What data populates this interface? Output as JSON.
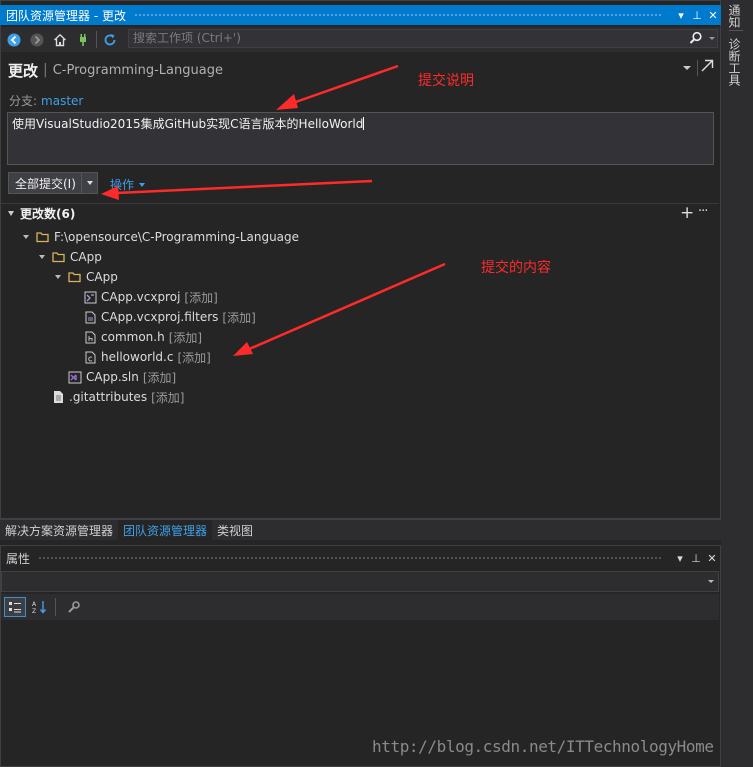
{
  "window": {
    "title": "团队资源管理器 - 更改",
    "controls": {
      "dropdown": "▾",
      "pin": "⊥",
      "close": "✕"
    }
  },
  "toolbar": {
    "buttons": [
      "back-icon",
      "forward-icon",
      "home-icon",
      "connect-icon",
      "refresh-icon"
    ],
    "search_placeholder": "搜索工作项 (Ctrl+')"
  },
  "page": {
    "title": "更改",
    "separator": "|",
    "repo": "C-Programming-Language"
  },
  "branch": {
    "label": "分支:",
    "value": "master"
  },
  "commit": {
    "message": "使用VisualStudio2015集成GitHub实现C语言版本的HelloWorld",
    "button_label": "全部提交(I)",
    "actions_label": "操作"
  },
  "changes": {
    "header": "更改数(6)",
    "add": "+",
    "more": "···",
    "tree": {
      "root": "F:\\opensource\\C-Programming-Language",
      "folder1": "CApp",
      "folder2": "CApp",
      "files": [
        {
          "name": "CApp.vcxproj",
          "tag": "[添加]"
        },
        {
          "name": "CApp.vcxproj.filters",
          "tag": "[添加]"
        },
        {
          "name": "common.h",
          "tag": "[添加]"
        },
        {
          "name": "helloworld.c",
          "tag": "[添加]"
        }
      ],
      "sln": {
        "name": "CApp.sln",
        "tag": "[添加]"
      },
      "gitattr": {
        "name": ".gitattributes",
        "tag": "[添加]"
      }
    }
  },
  "annotations": {
    "commit_note": "提交说明",
    "commit_content": "提交的内容",
    "color": "#ff2a2a"
  },
  "bottom_tabs": [
    {
      "label": "解决方案资源管理器",
      "active": false
    },
    {
      "label": "团队资源管理器",
      "active": true
    },
    {
      "label": "类视图",
      "active": false
    }
  ],
  "properties": {
    "title": "属性",
    "controls": {
      "dropdown": "▾",
      "pin": "⊥",
      "close": "✕"
    }
  },
  "side_tabs": {
    "notifications": "通知",
    "diagnostics": "诊断工具"
  },
  "watermark": "http://blog.csdn.net/ITTechnologyHome",
  "colors": {
    "accent": "#007acc",
    "link": "#3fa0e8",
    "background": "#252526"
  }
}
